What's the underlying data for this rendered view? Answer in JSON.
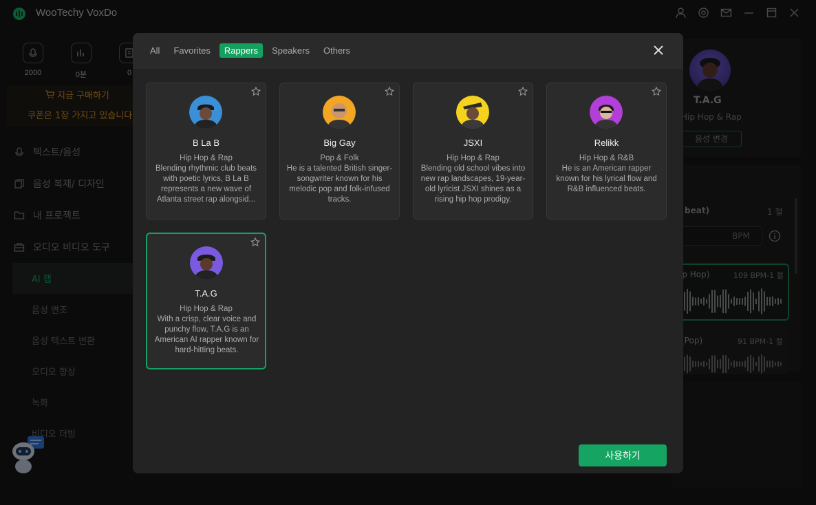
{
  "app": {
    "title": "WooTechy VoxDo"
  },
  "sidebar": {
    "stats": [
      {
        "value": "2000",
        "icon": "voice-credits-icon"
      },
      {
        "value": "0분",
        "icon": "minutes-icon"
      },
      {
        "value": "0",
        "icon": "files-icon"
      }
    ],
    "buy_label": "지금 구매하기",
    "coupon_text": "쿠폰은 1장 가지고 있습니다",
    "nav": [
      {
        "label": "텍스트/음성",
        "icon": "voice-icon"
      },
      {
        "label": "음성 복제/ 디자인",
        "icon": "clone-icon"
      },
      {
        "label": "내 프로젝트",
        "icon": "folder-icon"
      },
      {
        "label": "오디오 비디오 도구",
        "icon": "toolbox-icon"
      }
    ],
    "sub_nav": [
      {
        "label": "AI 랩",
        "active": true
      },
      {
        "label": "음성 변조"
      },
      {
        "label": "음성 텍스트 변환"
      },
      {
        "label": "오디오 향상"
      },
      {
        "label": "녹화"
      },
      {
        "label": "비디오 더빙"
      }
    ]
  },
  "right_panel": {
    "name": "T.A.G",
    "genre": "Hip Hop & Rap",
    "change_voice": "음성 변경",
    "beat_title": "beat)",
    "beat_count": "1 절",
    "bpm_label": "BPM",
    "cards": [
      {
        "label": "ip Hop)",
        "bpm": "109 BPM-1 절"
      },
      {
        "label": "(Pop)",
        "bpm": "91 BPM-1 절"
      }
    ]
  },
  "modal": {
    "tabs": [
      {
        "label": "All"
      },
      {
        "label": "Favorites"
      },
      {
        "label": "Rappers",
        "active": true
      },
      {
        "label": "Speakers"
      },
      {
        "label": "Others"
      }
    ],
    "voices": [
      {
        "name": "B La B",
        "genre": "Hip Hop & Rap",
        "desc": "Blending rhythmic club beats with poetic lyrics, B La B represents a new wave of Atlanta street rap alongsid...",
        "color": "#3a8fd6"
      },
      {
        "name": "Big Gay",
        "genre": "Pop & Folk",
        "desc": "He is a talented British singer-songwriter known for his melodic pop and folk-infused tracks.",
        "color": "#f2a623"
      },
      {
        "name": "JSXI",
        "genre": "Hip Hop & Rap",
        "desc": "Blending old school vibes into new rap landscapes, 19-year-old lyricist JSXI shines as a rising hip hop prodigy.",
        "color": "#f5d21e"
      },
      {
        "name": "Relikk",
        "genre": "Hip Hop & R&B",
        "desc": "He is an American rapper known for his lyrical flow and R&B influenced beats.",
        "color": "#b23fd8"
      },
      {
        "name": "T.A.G",
        "genre": "Hip Hop & Rap",
        "desc": "With a crisp, clear voice and punchy flow, T.A.G is an American AI rapper known for hard-hitting beats.",
        "color": "#7a5ae0",
        "selected": true
      }
    ],
    "use_button": "사용하기"
  }
}
